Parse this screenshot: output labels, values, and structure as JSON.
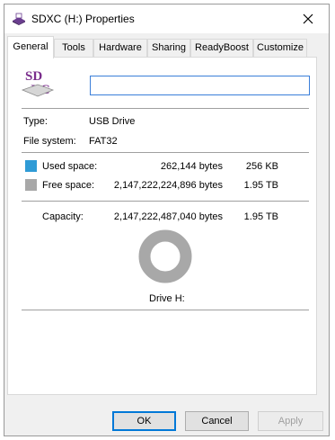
{
  "window": {
    "title": "SDXC (H:) Properties",
    "close_label": "✕"
  },
  "tabs": [
    {
      "label": "General",
      "active": true
    },
    {
      "label": "Tools",
      "active": false
    },
    {
      "label": "Hardware",
      "active": false
    },
    {
      "label": "Sharing",
      "active": false
    },
    {
      "label": "ReadyBoost",
      "active": false
    },
    {
      "label": "Customize",
      "active": false
    }
  ],
  "drive": {
    "icon_text": "SD\nXC",
    "name_value": ""
  },
  "info": {
    "type_label": "Type:",
    "type_value": "USB Drive",
    "fs_label": "File system:",
    "fs_value": "FAT32"
  },
  "space": {
    "used_label": "Used space:",
    "used_bytes": "262,144 bytes",
    "used_short": "256 KB",
    "used_color": "#2f9bd6",
    "free_label": "Free space:",
    "free_bytes": "2,147,222,224,896 bytes",
    "free_short": "1.95 TB",
    "free_color": "#a8a8a8",
    "capacity_label": "Capacity:",
    "capacity_bytes": "2,147,222,487,040 bytes",
    "capacity_short": "1.95 TB",
    "used_fraction": 1e-07
  },
  "chart_caption": "Drive H:",
  "buttons": {
    "ok": "OK",
    "cancel": "Cancel",
    "apply": "Apply"
  }
}
